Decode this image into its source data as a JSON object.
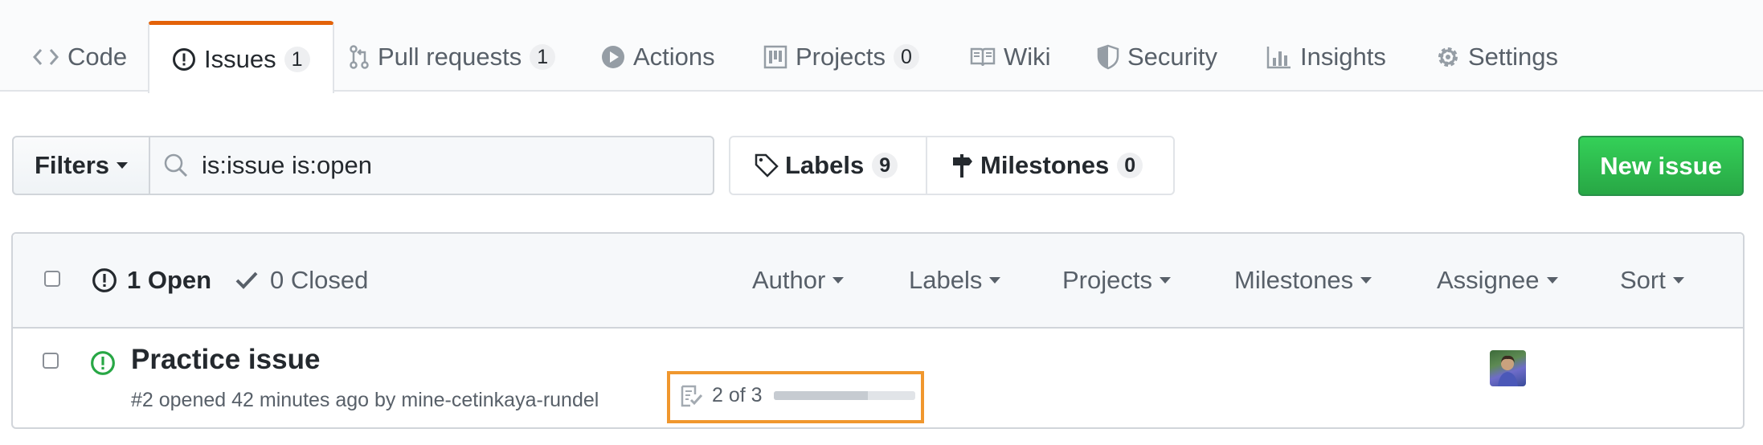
{
  "tabs": [
    {
      "label": "Code",
      "icon": "code-icon"
    },
    {
      "label": "Issues",
      "count": "1",
      "icon": "issue-opened-icon"
    },
    {
      "label": "Pull requests",
      "count": "1",
      "icon": "git-pull-request-icon"
    },
    {
      "label": "Actions",
      "icon": "play-icon"
    },
    {
      "label": "Projects",
      "count": "0",
      "icon": "project-icon"
    },
    {
      "label": "Wiki",
      "icon": "book-icon"
    },
    {
      "label": "Security",
      "icon": "shield-icon"
    },
    {
      "label": "Insights",
      "icon": "graph-icon"
    },
    {
      "label": "Settings",
      "icon": "gear-icon"
    }
  ],
  "toolbar": {
    "filters_label": "Filters",
    "search_value": "is:issue is:open",
    "labels_label": "Labels",
    "labels_count": "9",
    "milestones_label": "Milestones",
    "milestones_count": "0",
    "new_issue_label": "New issue"
  },
  "header": {
    "open_label": "1 Open",
    "closed_label": "0 Closed",
    "menus": [
      "Author",
      "Labels",
      "Projects",
      "Milestones",
      "Assignee",
      "Sort"
    ]
  },
  "issues": [
    {
      "title": "Practice issue",
      "meta": "#2 opened 42 minutes ago by mine-cetinkaya-rundel",
      "tasks": "2 of 3",
      "tasks_done": 2,
      "tasks_total": 3
    }
  ],
  "colors": {
    "accent_tab": "#e36209",
    "open_green": "#28a745",
    "highlight": "#f0972e"
  }
}
